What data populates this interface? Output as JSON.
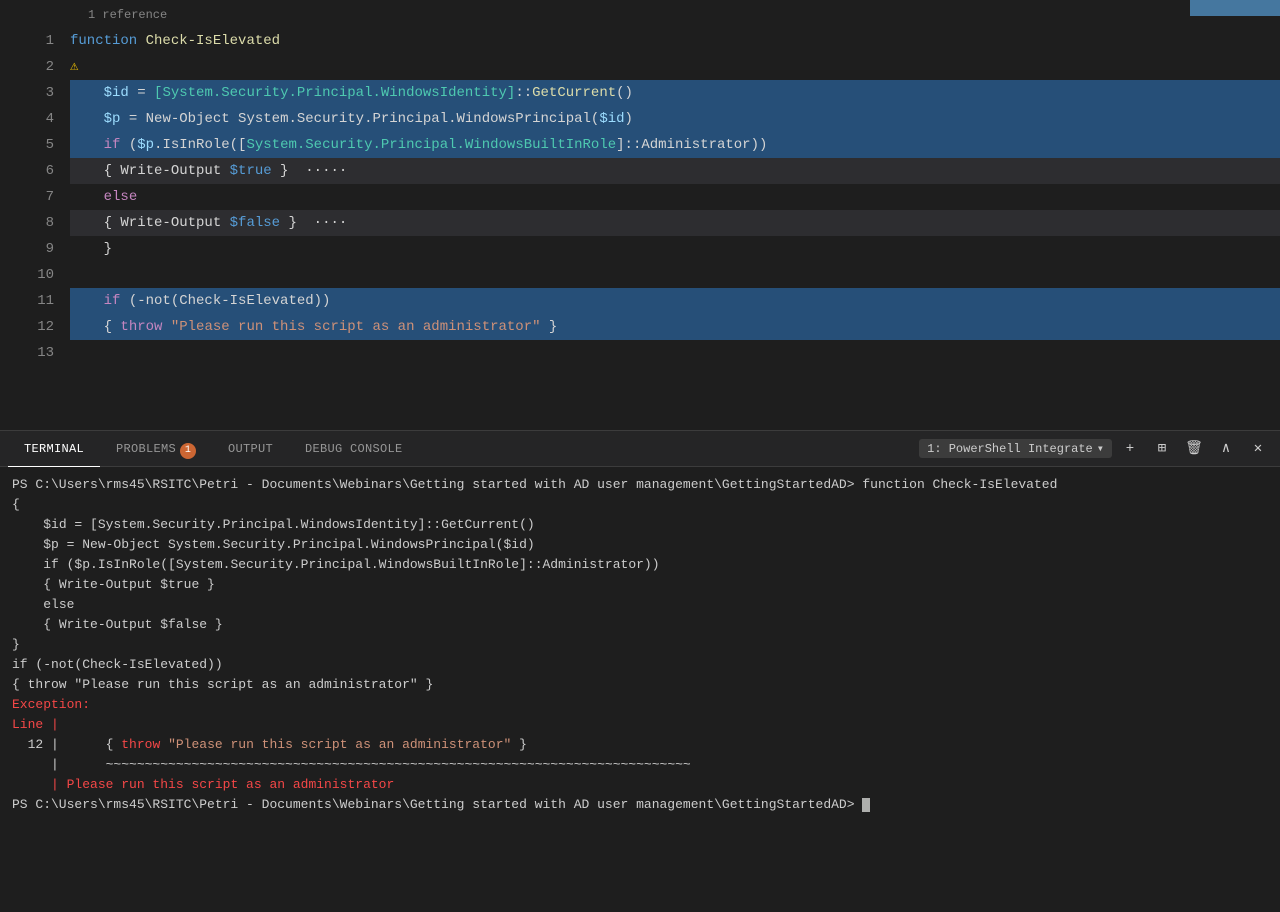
{
  "editor": {
    "ref_hint": "1 reference",
    "lines": [
      {
        "num": "1",
        "tokens": [
          {
            "t": "function ",
            "c": "kw-function"
          },
          {
            "t": "Check-IsElevated",
            "c": "fn-name"
          }
        ],
        "bg": ""
      },
      {
        "num": "2",
        "tokens": [
          {
            "t": "⚠",
            "c": "lightbulb"
          }
        ],
        "bg": ""
      },
      {
        "num": "3",
        "tokens": [
          {
            "t": "    ",
            "c": "plain"
          },
          {
            "t": "$id",
            "c": "var-name"
          },
          {
            "t": " = ",
            "c": "plain"
          },
          {
            "t": "[System.Security.Principal.WindowsIdentity]",
            "c": "dot-access"
          },
          {
            "t": "::",
            "c": "plain"
          },
          {
            "t": "GetCurrent",
            "c": "method-call"
          },
          {
            "t": "()",
            "c": "plain"
          }
        ],
        "bg": "line-selected"
      },
      {
        "num": "4",
        "tokens": [
          {
            "t": "    ",
            "c": "plain"
          },
          {
            "t": "$p",
            "c": "var-name"
          },
          {
            "t": " = ",
            "c": "plain"
          },
          {
            "t": "New-Object",
            "c": "plain"
          },
          {
            "t": " System.Security.Principal.WindowsPrincipal(",
            "c": "plain"
          },
          {
            "t": "$id",
            "c": "var-name"
          },
          {
            "t": ")",
            "c": "plain"
          }
        ],
        "bg": "line-selected"
      },
      {
        "num": "5",
        "tokens": [
          {
            "t": "    ",
            "c": "plain"
          },
          {
            "t": "if",
            "c": "kw-if"
          },
          {
            "t": " (",
            "c": "plain"
          },
          {
            "t": "$p",
            "c": "var-name"
          },
          {
            "t": ".IsInRole([",
            "c": "plain"
          },
          {
            "t": "System.Security.Principal.WindowsBuiltInRole",
            "c": "dot-access"
          },
          {
            "t": "]:",
            "c": "plain"
          },
          {
            "t": ":Administrator))",
            "c": "plain"
          }
        ],
        "bg": "line-selected"
      },
      {
        "num": "6",
        "tokens": [
          {
            "t": "    { Write-Output ",
            "c": "plain"
          },
          {
            "t": "$true",
            "c": "bool-blue"
          },
          {
            "t": " }  ·····",
            "c": "plain"
          }
        ],
        "bg": "line-highlight-light"
      },
      {
        "num": "7",
        "tokens": [
          {
            "t": "    ",
            "c": "plain"
          },
          {
            "t": "else",
            "c": "kw-else"
          }
        ],
        "bg": ""
      },
      {
        "num": "8",
        "tokens": [
          {
            "t": "    { Write-Output ",
            "c": "plain"
          },
          {
            "t": "$false",
            "c": "bool-blue"
          },
          {
            "t": " }  ····",
            "c": "plain"
          }
        ],
        "bg": "line-highlight-light"
      },
      {
        "num": "9",
        "tokens": [
          {
            "t": "    }",
            "c": "plain"
          }
        ],
        "bg": ""
      },
      {
        "num": "10",
        "tokens": [],
        "bg": ""
      },
      {
        "num": "11",
        "tokens": [
          {
            "t": "    ",
            "c": "plain"
          },
          {
            "t": "if",
            "c": "kw-if"
          },
          {
            "t": " (-not(Check-IsElevated))",
            "c": "plain"
          }
        ],
        "bg": "line-selected"
      },
      {
        "num": "12",
        "tokens": [
          {
            "t": "    { ",
            "c": "plain"
          },
          {
            "t": "throw",
            "c": "kw-throw"
          },
          {
            "t": " ",
            "c": "plain"
          },
          {
            "t": "\"Please run this script as an administrator\"",
            "c": "string-red"
          },
          {
            "t": " }",
            "c": "plain"
          }
        ],
        "bg": "line-selected"
      },
      {
        "num": "13",
        "tokens": [],
        "bg": ""
      }
    ]
  },
  "terminal": {
    "tabs": [
      {
        "label": "TERMINAL",
        "active": true,
        "badge": null
      },
      {
        "label": "PROBLEMS",
        "active": false,
        "badge": "1"
      },
      {
        "label": "OUTPUT",
        "active": false,
        "badge": null
      },
      {
        "label": "DEBUG CONSOLE",
        "active": false,
        "badge": null
      }
    ],
    "selector_label": "1: PowerShell Integrate",
    "actions": [
      "+",
      "⊞",
      "🗑",
      "∧",
      "✕"
    ],
    "output_lines": [
      {
        "text": "PS C:\\Users\\rms45\\RSITC\\Petri - Documents\\Webinars\\Getting started with AD user management\\GettingStartedAD> function Check-IsElevated",
        "color": ""
      },
      {
        "text": "{",
        "color": ""
      },
      {
        "text": "    $id = [System.Security.Principal.WindowsIdentity]::GetCurrent()",
        "color": ""
      },
      {
        "text": "    $p = New-Object System.Security.Principal.WindowsPrincipal($id)",
        "color": ""
      },
      {
        "text": "    if ($p.IsInRole([System.Security.Principal.WindowsBuiltInRole]::Administrator))",
        "color": ""
      },
      {
        "text": "    { Write-Output $true }",
        "color": ""
      },
      {
        "text": "    else",
        "color": ""
      },
      {
        "text": "    { Write-Output $false }",
        "color": ""
      },
      {
        "text": "}",
        "color": ""
      },
      {
        "text": "",
        "color": ""
      },
      {
        "text": "if (-not(Check-IsElevated))",
        "color": ""
      },
      {
        "text": "{ throw \"Please run this script as an administrator\" }",
        "color": ""
      },
      {
        "text": "Exception:",
        "color": "t-red"
      },
      {
        "text": "Line |",
        "color": "t-red"
      },
      {
        "text": "  12 |      { throw \"Please run this script as an administrator\" }",
        "color": ""
      },
      {
        "text": "     |      ~~~~~~~~~~~~~~~~~~~~~~~~~~~~~~~~~~~~~~~~~~~~~~~~~~~~~~~~~~~~~~~~~~~~~~~~~~~",
        "color": ""
      },
      {
        "text": "     | Please run this script as an administrator",
        "color": "t-red"
      },
      {
        "text": "PS C:\\Users\\rms45\\RSITC\\Petri - Documents\\Webinars\\Getting started with AD user management\\GettingStartedAD> ",
        "color": ""
      }
    ]
  }
}
